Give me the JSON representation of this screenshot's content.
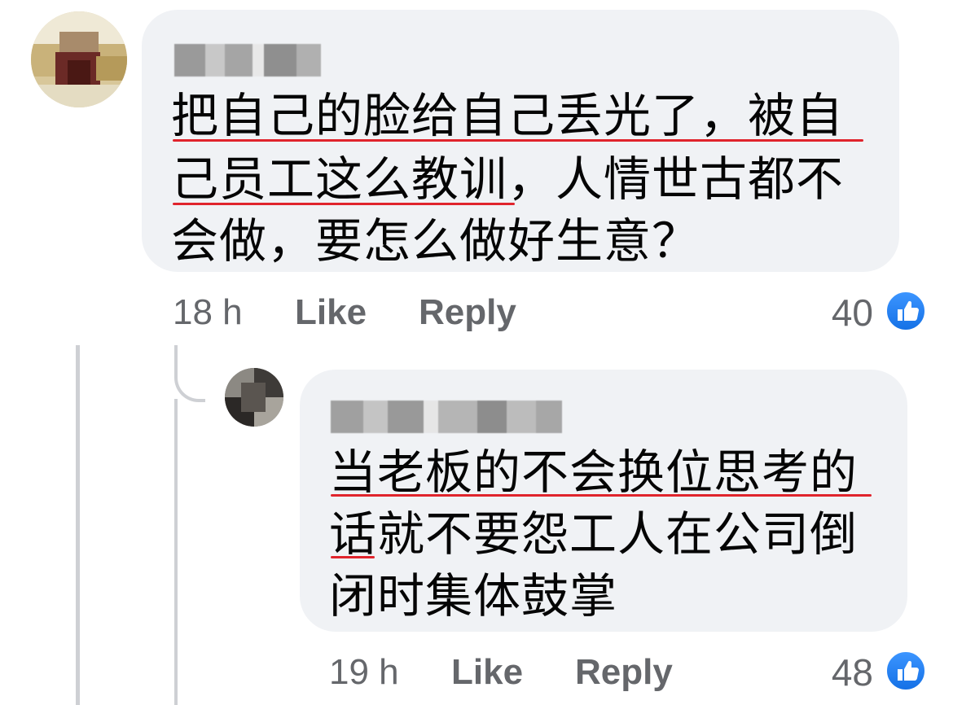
{
  "comments": [
    {
      "author": "Fxxx Hxx",
      "text_lines": [
        "把自己的脸给自己丢光了，被自",
        "己员工这么教训，人情世古都不",
        "会做，要怎么做好生意？"
      ],
      "time": "18 h",
      "like_label": "Like",
      "reply_label": "Reply",
      "reaction_count": "40",
      "reaction_icon": "thumbs-up-icon"
    },
    {
      "author": "Kxxx Cxxxx",
      "text_lines": [
        "当老板的不会换位思考的",
        "话就不要怨工人在公司倒",
        "闭时集体鼓掌"
      ],
      "time": "19 h",
      "like_label": "Like",
      "reply_label": "Reply",
      "reaction_count": "48",
      "reaction_icon": "thumbs-up-icon"
    }
  ],
  "colors": {
    "bubble": "#f0f2f5",
    "text": "#050505",
    "meta": "#65676b",
    "like_blue": "#1877f2",
    "spellcheck_underline": "#e0242c"
  }
}
